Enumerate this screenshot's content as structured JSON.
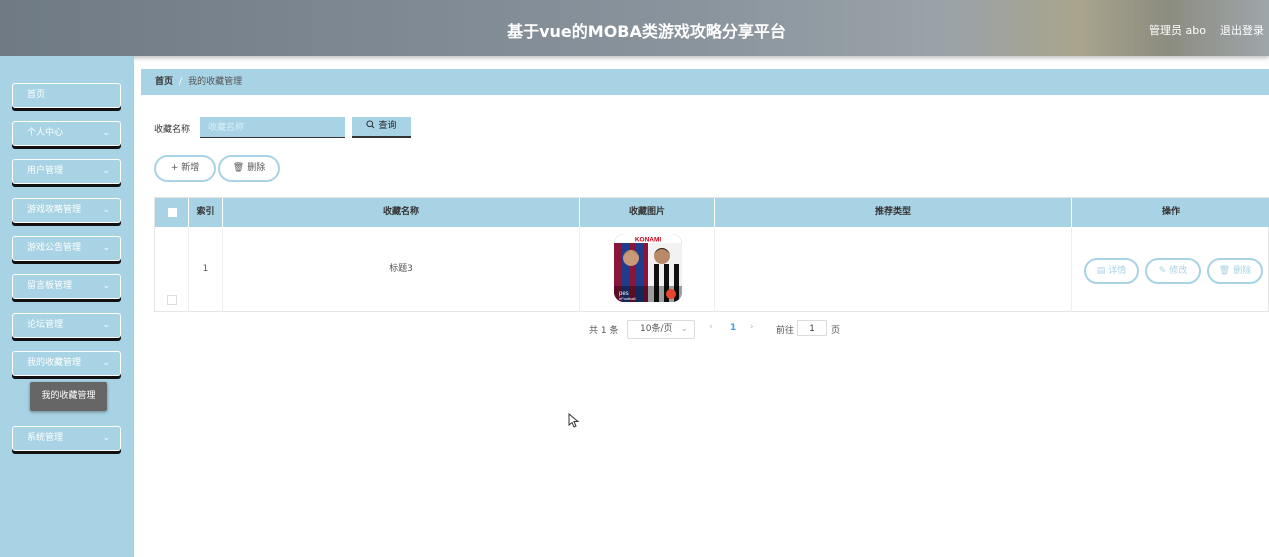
{
  "header": {
    "title": "基于vue的MOBA类游戏攻略分享平台",
    "user": "管理员 abo",
    "logout": "退出登录"
  },
  "sidebar": {
    "items": [
      {
        "label": "首页",
        "has_children": false
      },
      {
        "label": "个人中心",
        "has_children": true
      },
      {
        "label": "用户管理",
        "has_children": true
      },
      {
        "label": "游戏攻略管理",
        "has_children": true
      },
      {
        "label": "游戏公告管理",
        "has_children": true
      },
      {
        "label": "留言板管理",
        "has_children": true
      },
      {
        "label": "论坛管理",
        "has_children": true
      },
      {
        "label": "我的收藏管理",
        "has_children": true
      },
      {
        "label": "系统管理",
        "has_children": true
      }
    ],
    "open_submenu": {
      "label": "我的收藏管理"
    }
  },
  "breadcrumb": {
    "home": "首页",
    "current": "我的收藏管理"
  },
  "search": {
    "label": "收藏名称",
    "placeholder": "收藏名称",
    "value": "",
    "button": "查询"
  },
  "toolbar": {
    "add": "新增",
    "delete": "删除"
  },
  "table": {
    "columns": [
      "索引",
      "收藏名称",
      "收藏图片",
      "推荐类型",
      "操作"
    ],
    "rows": [
      {
        "index": "1",
        "name": "标题3",
        "image_alt": "KONAMI eFootball",
        "type": "",
        "actions": [
          "详情",
          "修改",
          "删除"
        ]
      }
    ]
  },
  "pagination": {
    "total": "共 1 条",
    "page_size": "10条/页",
    "current_page": "1",
    "goto_label": "前往",
    "goto_value": "1",
    "goto_suffix": "页"
  },
  "colors": {
    "accent": "#a8d3e4",
    "submenu": "#666666"
  }
}
